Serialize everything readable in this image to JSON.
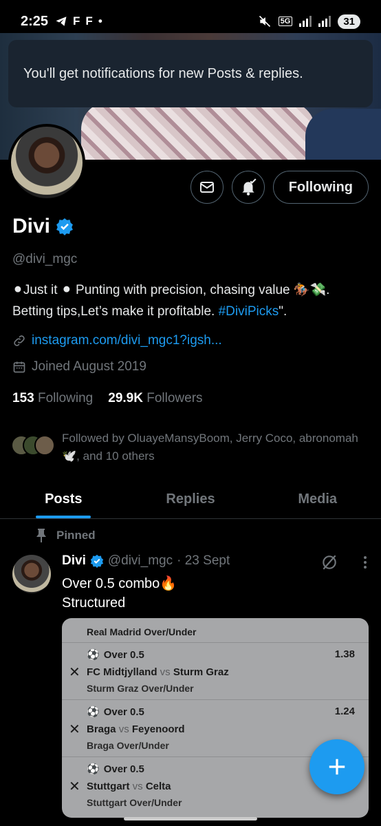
{
  "status_bar": {
    "time": "2:25",
    "network_label": "5G",
    "battery": "31"
  },
  "toast": {
    "message": "You'll get notifications for new Posts & replies."
  },
  "profile": {
    "name": "Divi",
    "handle": "@divi_mgc",
    "bio_text": "⚫Just it ⚫ Punting with precision, chasing value 🏇💸. Betting tips,Let’s make it profitable. ",
    "bio_hashtag": "#DiviPicks",
    "bio_end": "\".",
    "link": "instagram.com/divi_mgc1?igsh...",
    "joined": "Joined August 2019",
    "following_count": "153",
    "following_label": "Following",
    "followers_count": "29.9K",
    "followers_label": "Followers",
    "followed_by": "Followed by OluayeMansyBoom, Jerry Coco, abronomah 🕊️, and 10 others",
    "follow_button": "Following"
  },
  "tabs": [
    {
      "label": "Posts",
      "active": true
    },
    {
      "label": "Replies",
      "active": false
    },
    {
      "label": "Media",
      "active": false
    }
  ],
  "post": {
    "pinned_label": "Pinned",
    "author_name": "Divi",
    "author_handle": "@divi_mgc",
    "date": "· 23 Sept",
    "text_line1": "Over 0.5 combo🔥",
    "text_line2": "Structured",
    "slip": {
      "top_line": "Real Madrid Over/Under",
      "rows": [
        {
          "market": "Over 0.5",
          "odds": "1.38",
          "home": "FC Midtjylland",
          "vs": "vs",
          "away": "Sturm Graz",
          "sub": "Sturm Graz Over/Under"
        },
        {
          "market": "Over 0.5",
          "odds": "1.24",
          "home": "Braga",
          "vs": "vs",
          "away": "Feyenoord",
          "sub": "Braga Over/Under"
        },
        {
          "market": "Over 0.5",
          "odds": "",
          "home": "Stuttgart",
          "vs": "vs",
          "away": "Celta",
          "sub": "Stuttgart Over/Under"
        }
      ]
    }
  },
  "colors": {
    "accent": "#1d9bf0",
    "background": "#000000",
    "muted_text": "#71767b"
  }
}
